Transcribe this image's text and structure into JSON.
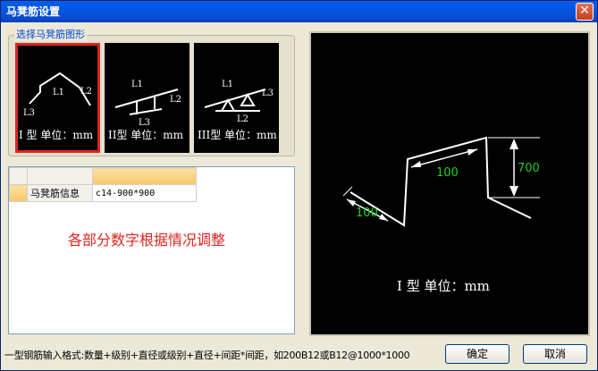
{
  "window": {
    "title": "马凳筋设置",
    "close_glyph": "✕"
  },
  "shape_group": {
    "legend": "选择马凳筋图形",
    "shapes": [
      {
        "id": "type1",
        "caption": "I 型  单位：mm",
        "labels": [
          "L1",
          "L2",
          "L3"
        ],
        "selected": true
      },
      {
        "id": "type2",
        "caption": "II型  单位：mm",
        "labels": [
          "L1",
          "L2",
          "L3"
        ],
        "selected": false
      },
      {
        "id": "type3",
        "caption": "III型  单位：mm",
        "labels": [
          "L1",
          "L2",
          "L3"
        ],
        "selected": false
      }
    ]
  },
  "grid": {
    "rows": [
      {
        "name": "马凳筋信息",
        "value": "c14-900*900"
      }
    ]
  },
  "note": "各部分数字根据情况调整",
  "preview": {
    "caption": "I 型  单位：mm",
    "dims": {
      "a": "100",
      "b": "100",
      "c": "700"
    },
    "dim_color": "#1fd11f"
  },
  "footer": {
    "format_text": "一型钢筋输入格式:数量+级别+直径或级别+直径+间距*间距，如200B12或B12@1000*1000",
    "ok_label": "确定",
    "cancel_label": "取消"
  }
}
